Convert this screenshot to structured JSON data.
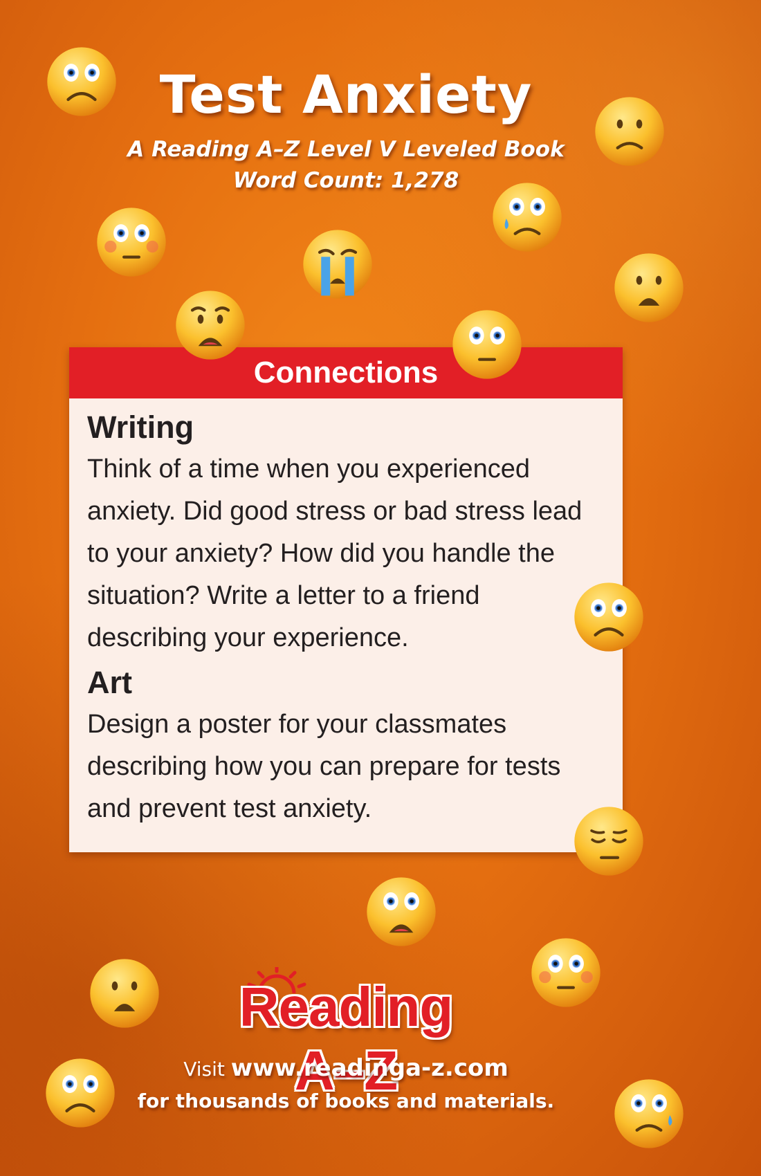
{
  "header": {
    "title": "Test Anxiety",
    "subtitle": "A Reading A–Z Level V Leveled Book",
    "word_count": "Word Count: 1,278"
  },
  "card": {
    "heading": "Connections",
    "sections": [
      {
        "title": "Writing",
        "text": "Think of a time when you experienced anxiety. Did good stress or bad stress lead to your anxiety? How did you handle the situation? Write a letter to a friend describing your experience."
      },
      {
        "title": "Art",
        "text": "Design a poster for your classmates describing how you can prepare for tests and prevent test anxiety."
      }
    ]
  },
  "footer": {
    "brand": "Reading A–Z",
    "visit_prefix": "Visit ",
    "url": "www.readinga-z.com",
    "tagline": "for thousands of books and materials."
  },
  "colors": {
    "background": "#e56f10",
    "header_bar": "#e21f26",
    "card_bg": "#fcefe8",
    "brand": "#e21f26"
  },
  "icons": [
    "worried-face-icon",
    "frowning-face-icon",
    "crying-face-icon",
    "flushed-face-icon",
    "anguished-face-icon",
    "relieved-face-icon",
    "sad-tear-face-icon"
  ]
}
